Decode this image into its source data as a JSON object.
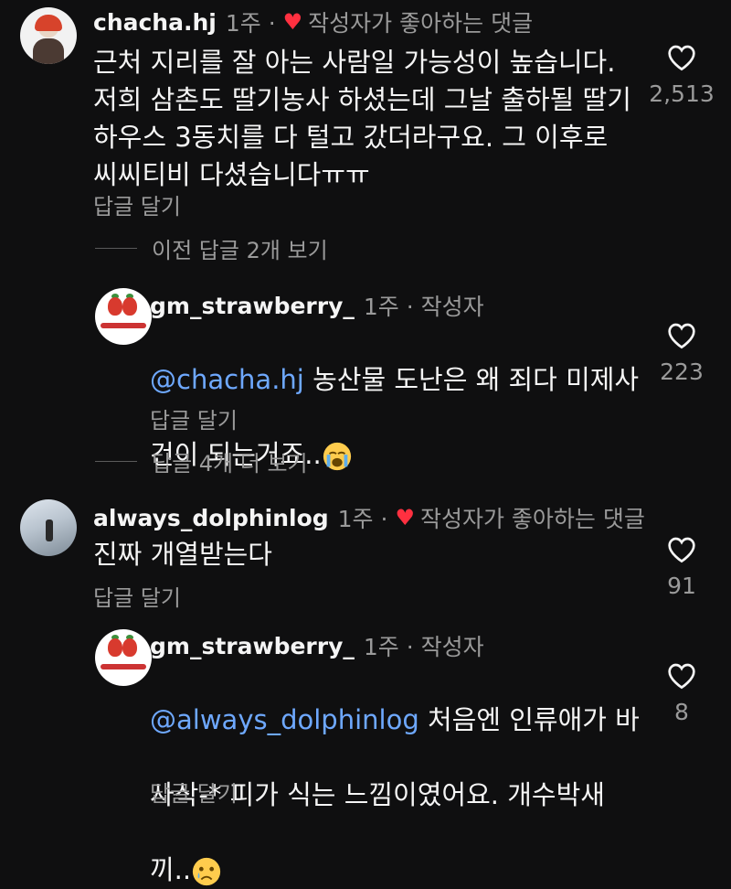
{
  "comments": [
    {
      "username": "chacha.hj",
      "meta": "1주 ·",
      "liked_text": "작성자가 좋아하는 댓글",
      "text": "근처 지리를 잘 아는 사람일 가능성이 높습니다.\n저희 삼촌도 딸기농사 하셨는데 그날 출하될 딸기\n하우스 3동치를 다 털고 갔더라구요. 그 이후로\n씨씨티비 다셨습니다ㅠㅠ",
      "reply_label": "답글 달기",
      "likes": "2,513",
      "thread_label": "이전 답글 2개 보기"
    },
    {
      "username": "gm_strawberry_",
      "meta": "1주 · 작성자",
      "mention": "@chacha.hj",
      "text_line1": " 농산물 도난은 왜 죄다 미제사",
      "text_line2": "건이 되는거죠..",
      "reply_label": "답글 달기",
      "likes": "223",
      "thread_label": "답글 4개 더 보기"
    },
    {
      "username": "always_dolphinlog",
      "meta": "1주 ·",
      "liked_text": "작성자가 좋아하는 댓글",
      "text": "진짜 개열받는다",
      "reply_label": "답글 달기",
      "likes": "91"
    },
    {
      "username": "gm_strawberry_",
      "meta": "1주 · 작성자",
      "mention": "@always_dolphinlog",
      "text_line1": " 처음엔 인류애가 바",
      "text_line2": "사삭-* 피가 식는 느낌이였어요.  개수박새",
      "text_line3": "끼..",
      "reply_label": "답글 달기",
      "likes": "8"
    }
  ],
  "icons": {
    "like": "heart-outline-icon",
    "liked_by_author": "heart-filled-icon",
    "crying": "loudly-crying-emoji",
    "sad": "crying-face-emoji"
  },
  "colors": {
    "background": "#0f0f10",
    "mention": "#6ea8fe",
    "heart": "#ff3040",
    "muted": "#9a9a9a"
  }
}
